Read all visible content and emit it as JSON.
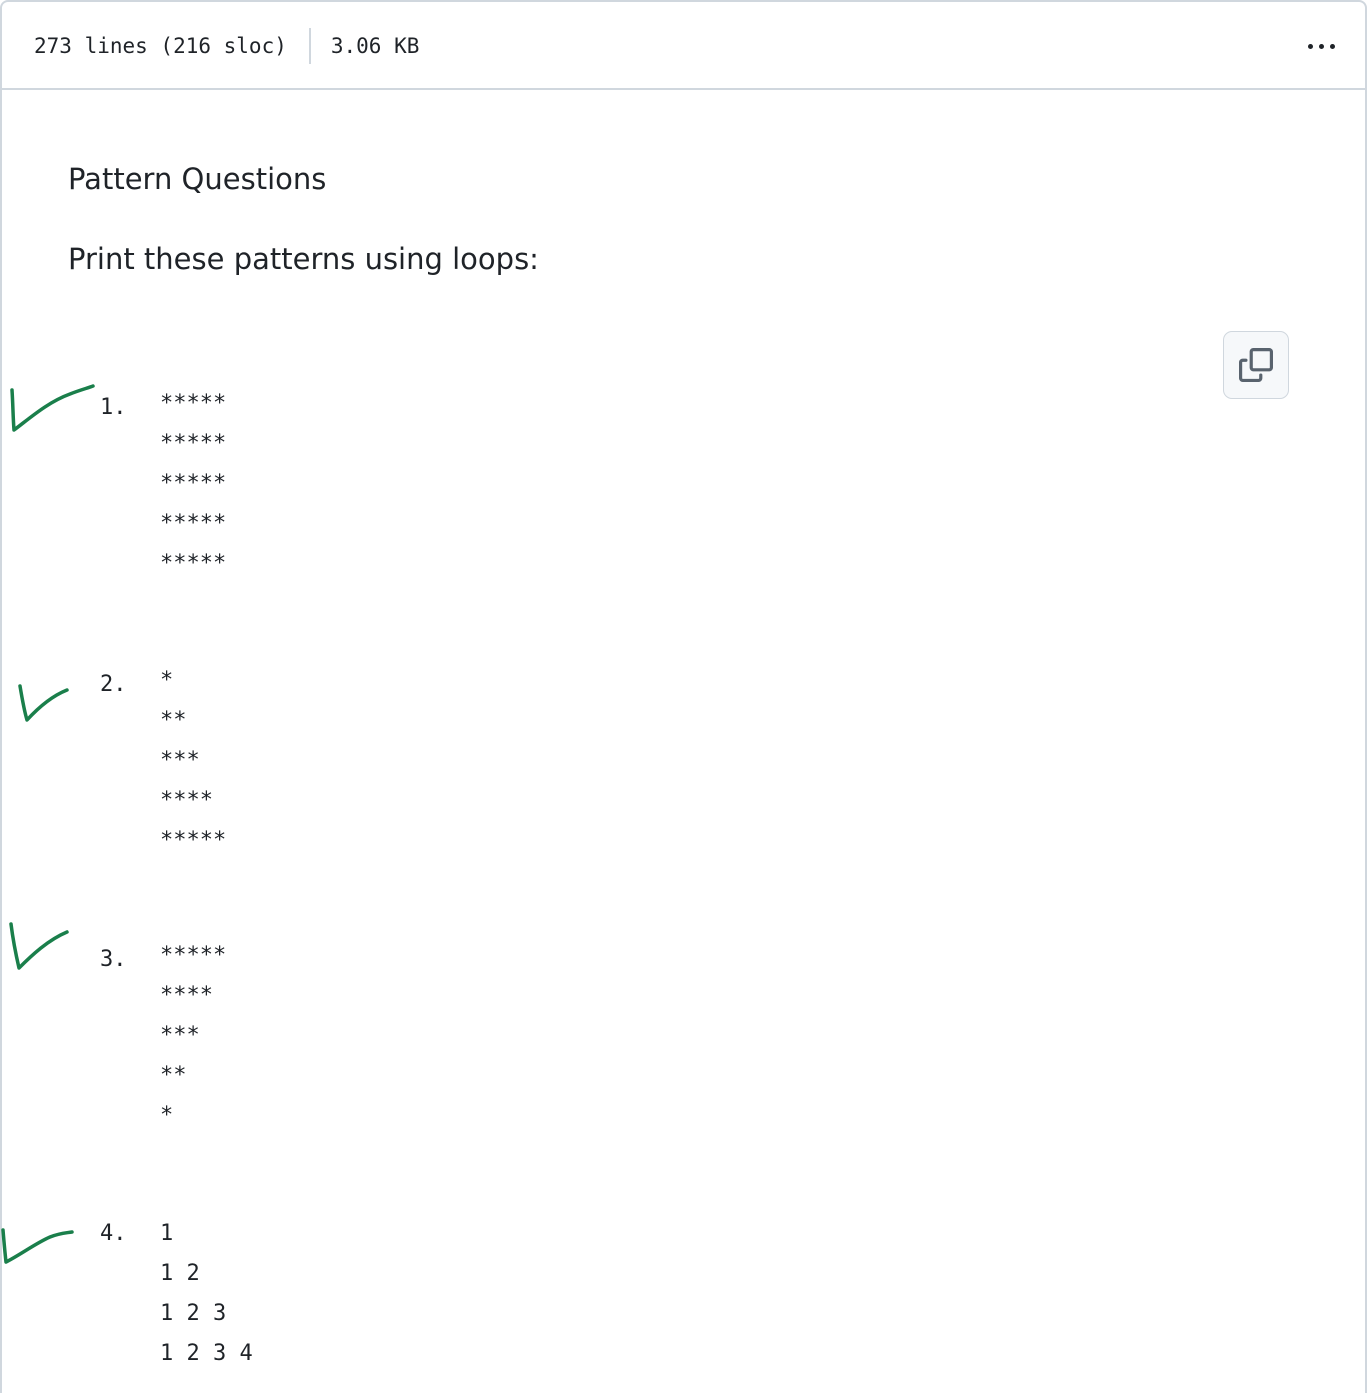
{
  "file_header": {
    "lines": "273 lines (216 sloc)",
    "size": "3.06 KB"
  },
  "readme": {
    "heading": "Pattern Questions",
    "intro": "Print these patterns using loops:"
  },
  "patterns": [
    {
      "number": "1.",
      "lines": [
        "*****",
        "*****",
        "*****",
        "*****",
        "*****"
      ]
    },
    {
      "number": "2.",
      "lines": [
        "*",
        "**",
        "***",
        "****",
        "*****"
      ]
    },
    {
      "number": "3.",
      "lines": [
        "*****",
        "****",
        "***",
        "**",
        "*"
      ]
    },
    {
      "number": "4.",
      "lines": [
        "1",
        "1 2",
        "1 2 3",
        "1 2 3 4"
      ]
    }
  ],
  "colors": {
    "check_mark": "#1a7f4b",
    "border": "#d0d7de",
    "text": "#1f2328"
  },
  "icons": {
    "more": "kebab-horizontal-icon",
    "copy": "copy-icon",
    "check": "handwritten-check-icon"
  }
}
